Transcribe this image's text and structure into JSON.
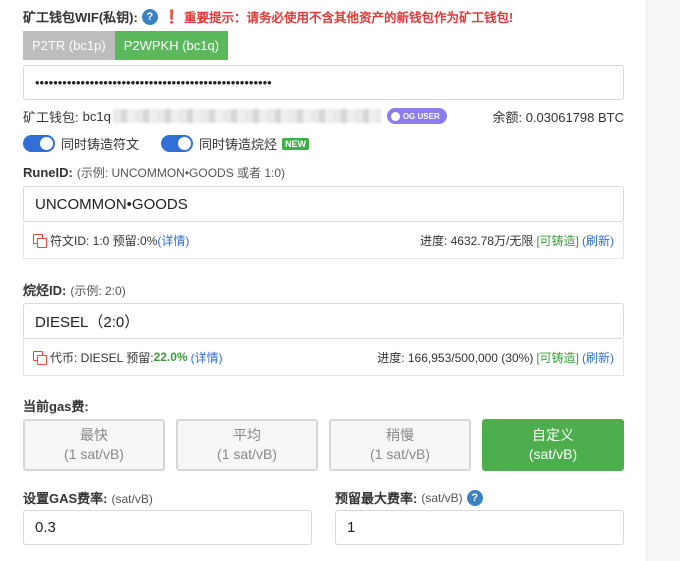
{
  "wif": {
    "label": "矿工钱包WIF(私钥):",
    "help_icon": "question-circle-icon",
    "warning": "重要提示：请务必使用不含其他资产的新钱包作为矿工钱包!",
    "tabs": [
      {
        "label": "P2TR (bc1p)",
        "active": false
      },
      {
        "label": "P2WPKH (bc1q)",
        "active": true
      }
    ],
    "masked_value": "••••••••••••••••••••••••••••••••••••••••••••••••••••"
  },
  "wallet": {
    "label": "矿工钱包:",
    "address_prefix": "bc1q",
    "badge": "OG USER",
    "balance": "余额: 0.03061798 BTC"
  },
  "toggles": {
    "mint_rune": {
      "label": "同时铸造符文",
      "on": true
    },
    "mint_alkane": {
      "label": "同时铸造烷烃",
      "on": true,
      "badge": "NEW"
    }
  },
  "rune": {
    "label": "RuneID:",
    "hint": "(示例: UNCOMMON•GOODS 或者 1:0)",
    "value": "UNCOMMON•GOODS",
    "info_prefix": "符文ID: 1:0 预留:0%",
    "details": "(详情)",
    "progress": "进度: 4632.78万/无限",
    "mintable": "[可铸造]",
    "refresh": "(刷新)"
  },
  "alkane": {
    "label": "烷烃ID:",
    "hint": "(示例: 2:0)",
    "value": "DIESEL（2:0）",
    "info_prefix": "代币: DIESEL 预留:",
    "reserve": "22.0%",
    "details": "(详情)",
    "progress": "进度: 166,953/500,000 (30%)",
    "mintable": "[可铸造]",
    "refresh": "(刷新)"
  },
  "gas": {
    "label": "当前gas费:",
    "options": [
      {
        "name": "最快",
        "rate": "(1 sat/vB)",
        "active": false
      },
      {
        "name": "平均",
        "rate": "(1 sat/vB)",
        "active": false
      },
      {
        "name": "稍慢",
        "rate": "(1 sat/vB)",
        "active": false
      },
      {
        "name": "自定义",
        "rate": "(sat/vB)",
        "active": true
      }
    ],
    "set_rate_label": "设置GAS费率:",
    "set_rate_unit": "(sat/vB)",
    "set_rate_value": "0.3",
    "max_rate_label": "预留最大费率:",
    "max_rate_unit": "(sat/vB)",
    "max_rate_value": "1"
  },
  "colors": {
    "accent_green": "#5cb85c",
    "toggle_blue": "#2f6fd6",
    "warning_red": "#e03a3a",
    "badge_purple": "#8b7cf0"
  }
}
